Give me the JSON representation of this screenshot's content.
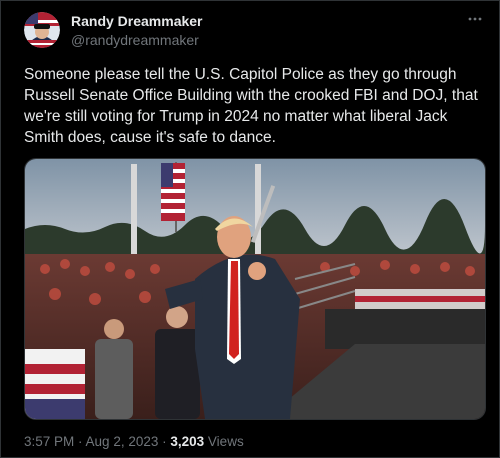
{
  "author": {
    "display_name": "Randy Dreammaker",
    "handle": "@randydreammaker"
  },
  "post": {
    "text": "Someone please tell the U.S. Capitol Police as they go through Russell Senate Office Building with the crooked FBI and DOJ, that we're still voting for Trump in 2024 no matter what liberal Jack Smith does, cause it's safe to dance."
  },
  "media": {
    "kind": "video-still"
  },
  "footer": {
    "time": "3:57 PM",
    "sep1": " · ",
    "date": "Aug 2, 2023",
    "sep2": " · ",
    "views_count": "3,203",
    "views_label": " Views"
  },
  "icons": {
    "more": "more-horizontal-icon"
  },
  "colors": {
    "background": "#000000",
    "primary_text": "#e7e9ea",
    "secondary_text": "#71767b",
    "border": "#2f3336"
  }
}
